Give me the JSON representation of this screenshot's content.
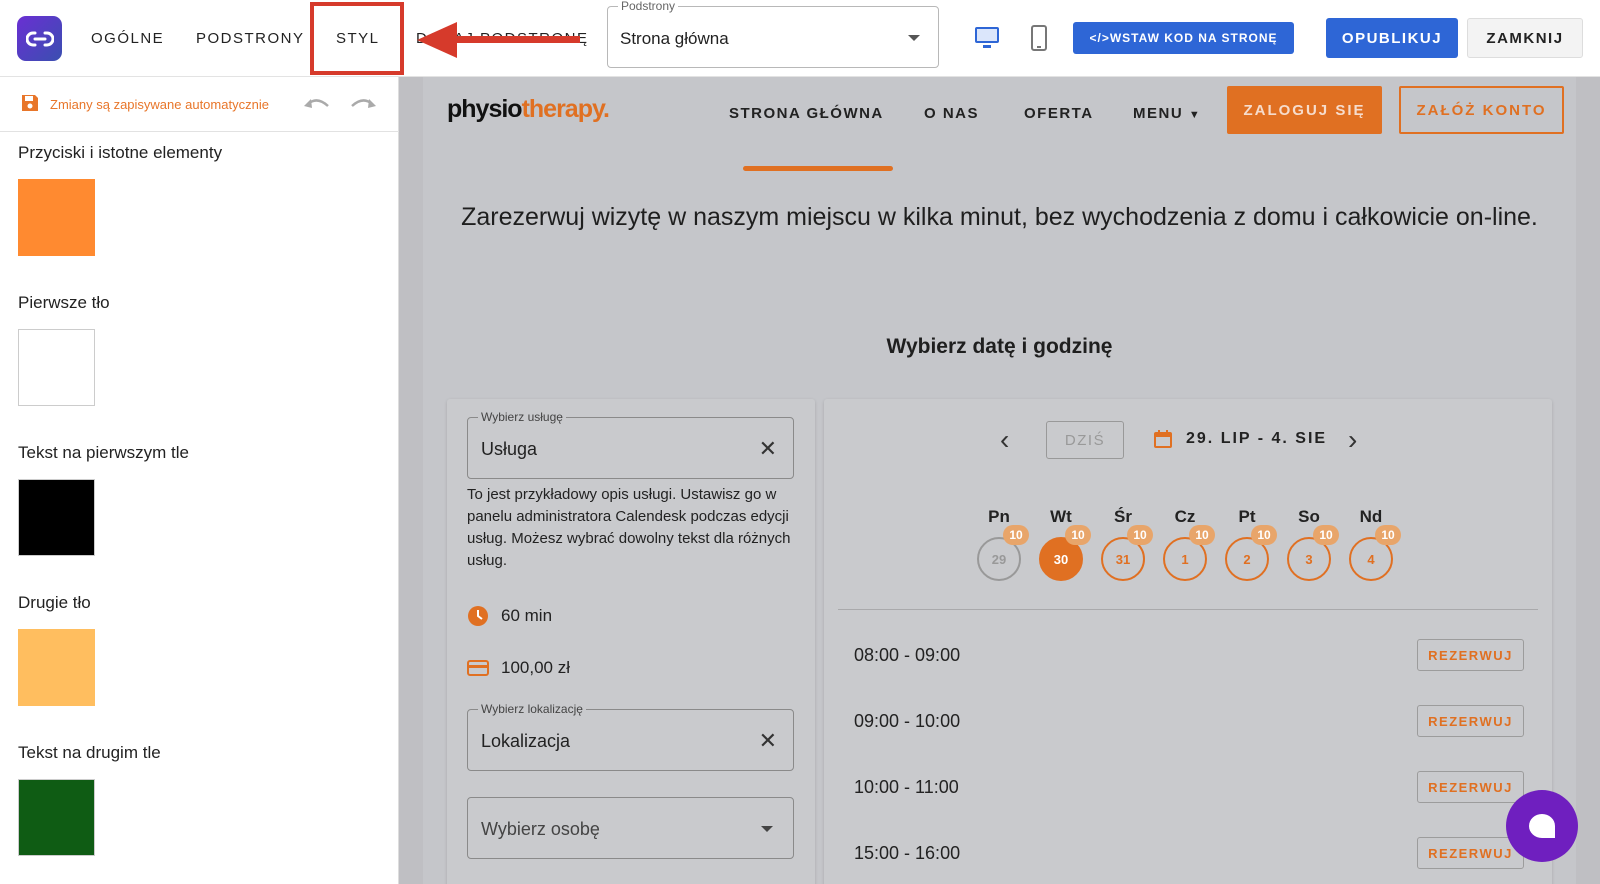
{
  "topbar": {
    "tabs": [
      "OGÓLNE",
      "PODSTRONY",
      "STYL",
      "DODAJ PODSTRONĘ"
    ],
    "subpages_label": "Podstrony",
    "subpages_value": "Strona główna",
    "embed_button": "</>WSTAW KOD NA STRONĘ",
    "publish_button": "OPUBLIKUJ",
    "close_button": "ZAMKNIJ"
  },
  "sidebar": {
    "autosave": "Zmiany są zapisywane automatycznie",
    "colors": [
      {
        "label": "Przyciski i istotne elementy",
        "color": "#FF8A30"
      },
      {
        "label": "Pierwsze tło",
        "color": "#FFFFFF"
      },
      {
        "label": "Tekst na pierwszym tle",
        "color": "#000000"
      },
      {
        "label": "Drugie tło",
        "color": "#FFBE5F"
      },
      {
        "label": "Tekst na drugim tle",
        "color": "#0F5C14"
      }
    ]
  },
  "preview": {
    "brand_physio": "physio",
    "brand_therapy": "therapy.",
    "nav": [
      "STRONA GŁÓWNA",
      "O NAS",
      "OFERTA",
      "MENU"
    ],
    "login": "ZALOGUJ SIĘ",
    "register": "ZAŁÓŻ KONTO",
    "hero": "Zarezerwuj wizytę w naszym miejscu w kilka minut, bez wychodzenia z domu i całkowicie on-line.",
    "subtitle": "Wybierz datę i godzinę",
    "service_label": "Wybierz usługę",
    "service_value": "Usługa",
    "service_desc": "To jest przykładowy opis usługi. Ustawisz go w panelu administratora Calendesk podczas edycji usług. Możesz wybrać dowolny tekst dla różnych usług.",
    "duration": "60 min",
    "price": "100,00 zł",
    "location_label": "Wybierz lokalizację",
    "location_value": "Lokalizacja",
    "person_placeholder": "Wybierz osobę",
    "today": "DZIŚ",
    "range": "29. LIP - 4. SIE",
    "days": [
      {
        "name": "Pn",
        "num": "29",
        "badge": "10",
        "state": "past"
      },
      {
        "name": "Wt",
        "num": "30",
        "badge": "10",
        "state": "selected"
      },
      {
        "name": "Śr",
        "num": "31",
        "badge": "10",
        "state": "normal"
      },
      {
        "name": "Cz",
        "num": "1",
        "badge": "10",
        "state": "normal"
      },
      {
        "name": "Pt",
        "num": "2",
        "badge": "10",
        "state": "normal"
      },
      {
        "name": "So",
        "num": "3",
        "badge": "10",
        "state": "normal"
      },
      {
        "name": "Nd",
        "num": "4",
        "badge": "10",
        "state": "normal"
      }
    ],
    "slots": [
      "08:00 - 09:00",
      "09:00 - 10:00",
      "10:00 - 11:00",
      "15:00 - 16:00"
    ],
    "book_label": "REZERWUJ"
  }
}
